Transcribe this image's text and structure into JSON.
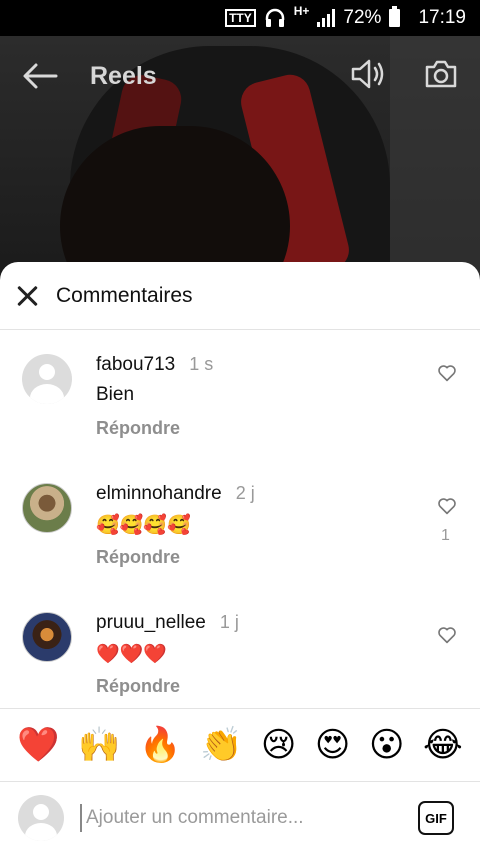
{
  "status_bar": {
    "tty": "TTY",
    "network": "H+",
    "battery": "72%",
    "time": "17:19"
  },
  "header": {
    "title": "Reels",
    "icons": [
      "back-arrow-icon",
      "speaker-icon",
      "camera-icon"
    ]
  },
  "sheet": {
    "title": "Commentaires"
  },
  "comments": [
    {
      "username": "fabou713",
      "time": "1 s",
      "text": "Bien",
      "reply_label": "Répondre",
      "likes": ""
    },
    {
      "username": "elminnohandre",
      "time": "2 j",
      "text": "🥰🥰🥰🥰",
      "reply_label": "Répondre",
      "likes": "1"
    },
    {
      "username": "pruuu_nellee",
      "time": "1 j",
      "text": "❤️❤️❤️",
      "reply_label": "Répondre",
      "likes": ""
    }
  ],
  "emoji_bar": [
    "❤️",
    "🙌",
    "🔥",
    "👏",
    "😢",
    "😍",
    "😮",
    "😂"
  ],
  "composer": {
    "placeholder": "Ajouter un commentaire...",
    "gif_label": "GIF"
  }
}
